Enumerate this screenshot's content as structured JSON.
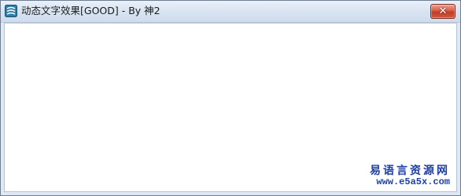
{
  "window": {
    "title": "动态文字效果[GOOD] - By 神2",
    "close_label": "✕"
  },
  "watermark": {
    "name": "易语言资源网",
    "url": "www.e5a5x.com"
  },
  "icons": {
    "app": "app-icon",
    "close": "close-icon"
  },
  "colors": {
    "title_bar": "#d7e3f1",
    "close_button": "#c13d26",
    "watermark": "#1d3fa6",
    "client_background": "#ffffff"
  }
}
